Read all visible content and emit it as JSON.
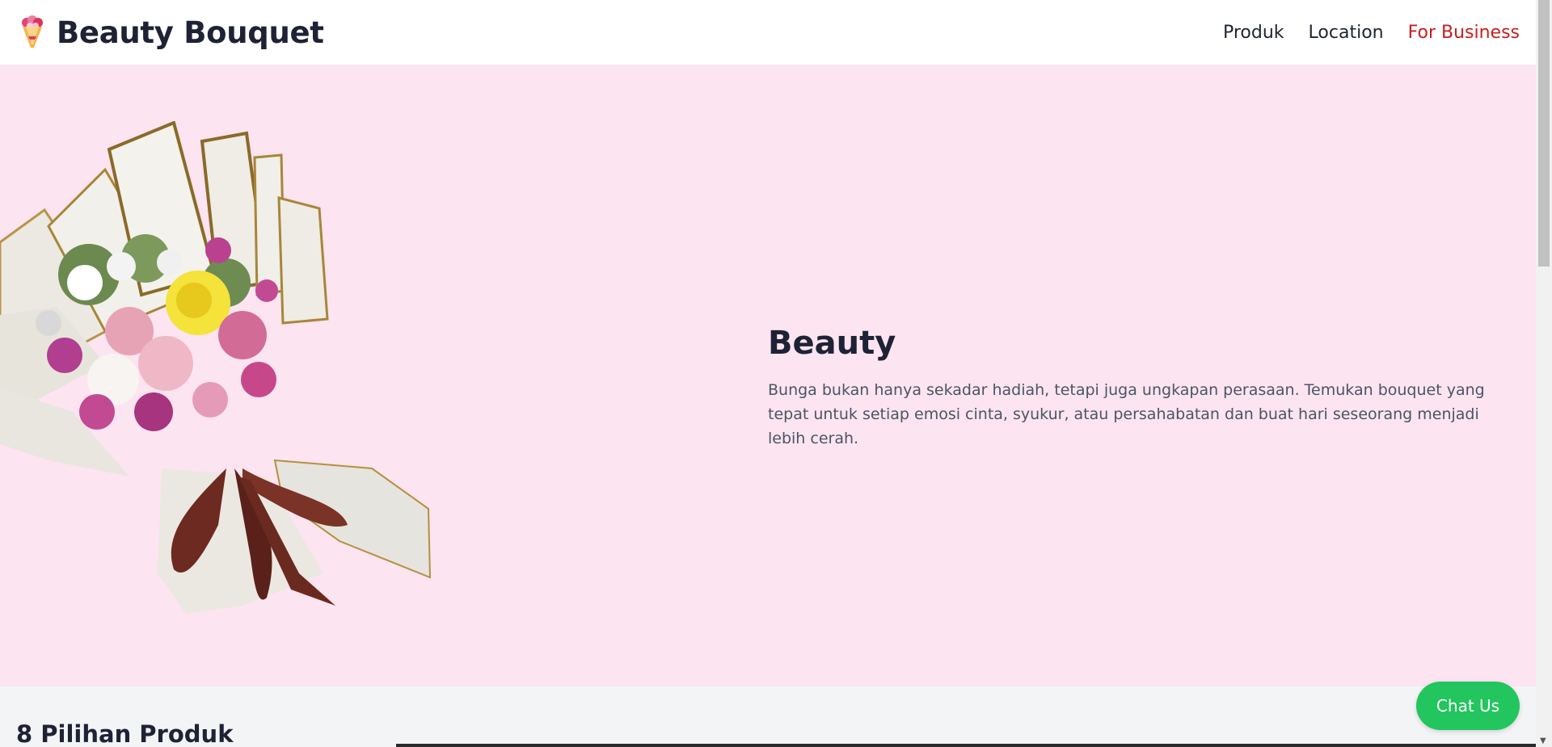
{
  "header": {
    "brand_name": "Beauty Bouquet",
    "nav": [
      {
        "label": "Produk"
      },
      {
        "label": "Location"
      },
      {
        "label": "For Business"
      }
    ]
  },
  "hero": {
    "title": "Beauty",
    "description": "Bunga bukan hanya sekadar hadiah, tetapi juga ungkapan perasaan. Temukan bouquet yang tepat untuk setiap emosi cinta, syukur, atau persahabatan dan buat hari seseorang menjadi lebih cerah."
  },
  "products": {
    "title": "8 Pilihan Produk"
  },
  "chat": {
    "label": "Chat Us"
  },
  "colors": {
    "hero_bg": "#fce4f1",
    "nav_accent": "#c81e1e",
    "chat_button": "#22c55e"
  },
  "icons": {
    "logo": "bouquet-logo-icon",
    "hero_image": "flower-bouquet-image"
  }
}
